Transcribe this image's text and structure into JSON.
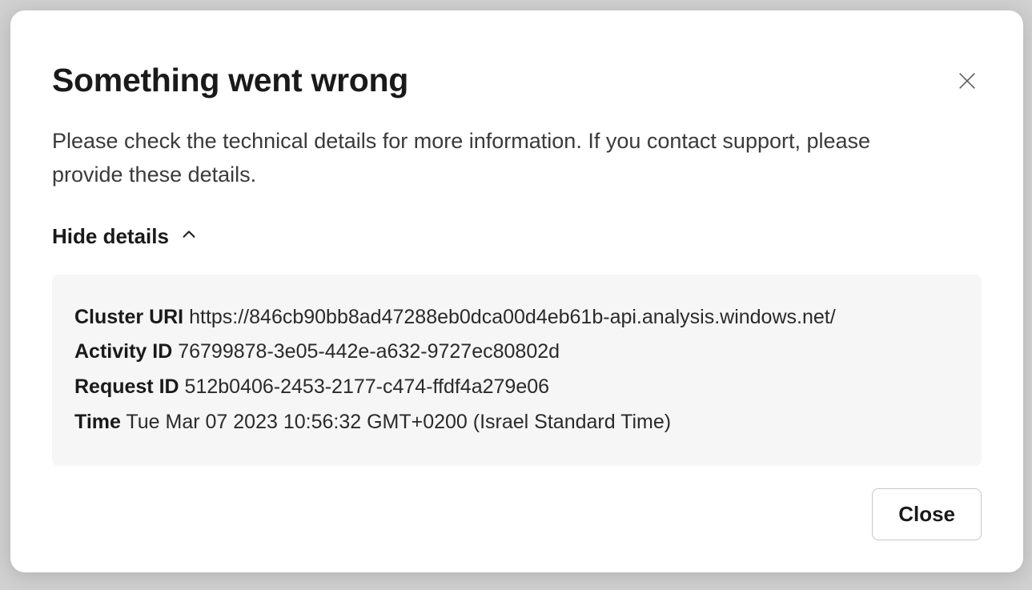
{
  "modal": {
    "title": "Something went wrong",
    "description": "Please check the technical details for more information. If you contact support, please provide these details.",
    "toggle_label": "Hide details",
    "close_button_label": "Close",
    "details": {
      "cluster_uri_label": "Cluster URI",
      "cluster_uri_value": "https://846cb90bb8ad47288eb0dca00d4eb61b-api.analysis.windows.net/",
      "activity_id_label": "Activity ID",
      "activity_id_value": "76799878-3e05-442e-a632-9727ec80802d",
      "request_id_label": "Request ID",
      "request_id_value": "512b0406-2453-2177-c474-ffdf4a279e06",
      "time_label": "Time",
      "time_value": "Tue Mar 07 2023 10:56:32 GMT+0200 (Israel Standard Time)"
    }
  }
}
